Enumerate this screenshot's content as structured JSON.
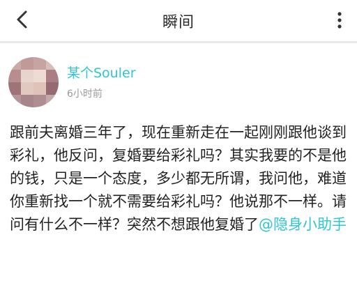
{
  "header": {
    "title": "瞬间",
    "back_icon": "chevron-left-icon",
    "more_icon": "more-vertical-icon"
  },
  "post": {
    "author": "某个Souler",
    "time": "6小时前",
    "avatar": "blurred-avatar",
    "text": "跟前夫离婚三年了，现在重新走在一起刚刚跟他谈到彩礼，他反问，复婚要给彩礼吗？其实我要的不是他的钱，只是一个态度，多少都无所谓，我问他，难道你重新找一个就不需要给彩礼吗？他说那不一样。请问有什么不一样？突然不想跟他复婚了",
    "mention": "@隐身小助手"
  },
  "colors": {
    "accent": "#2ec6d3",
    "text": "#222222",
    "muted": "#9a9a9a"
  }
}
